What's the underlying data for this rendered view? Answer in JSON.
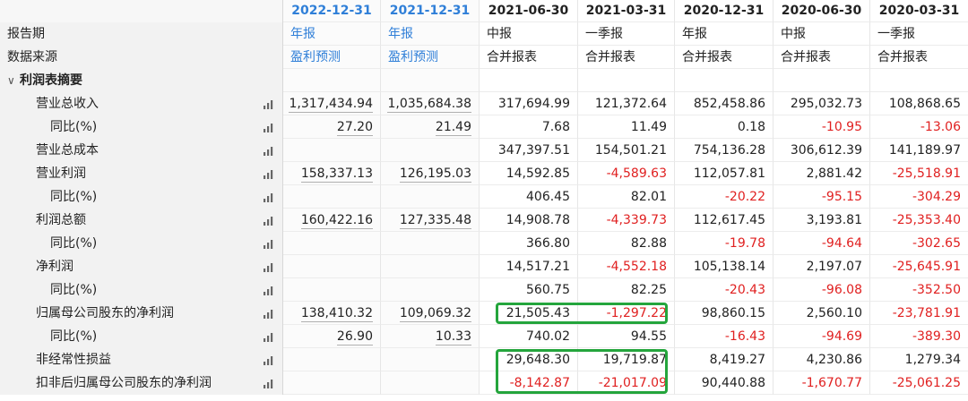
{
  "columns": [
    {
      "date": "2022-12-31",
      "report": "年报",
      "source": "盈利预测",
      "projected": true
    },
    {
      "date": "2021-12-31",
      "report": "年报",
      "source": "盈利预测",
      "projected": true
    },
    {
      "date": "2021-06-30",
      "report": "中报",
      "source": "合并报表",
      "projected": false
    },
    {
      "date": "2021-03-31",
      "report": "一季报",
      "source": "合并报表",
      "projected": false
    },
    {
      "date": "2020-12-31",
      "report": "年报",
      "source": "合并报表",
      "projected": false
    },
    {
      "date": "2020-06-30",
      "report": "中报",
      "source": "合并报表",
      "projected": false
    },
    {
      "date": "2020-03-31",
      "report": "一季报",
      "source": "合并报表",
      "projected": false
    }
  ],
  "header_rows": {
    "report_period_label": "报告期",
    "data_source_label": "数据来源"
  },
  "section": {
    "title": "利润表摘要",
    "caret": "∨"
  },
  "rows": [
    {
      "label": "营业总收入",
      "indent": 1,
      "values": [
        "1,317,434.94",
        "1,035,684.38",
        "317,694.99",
        "121,372.64",
        "852,458.86",
        "295,032.73",
        "108,868.65"
      ]
    },
    {
      "label": "同比(%)",
      "indent": 2,
      "values": [
        "27.20",
        "21.49",
        "7.68",
        "11.49",
        "0.18",
        "-10.95",
        "-13.06"
      ]
    },
    {
      "label": "营业总成本",
      "indent": 1,
      "values": [
        "",
        "",
        "347,397.51",
        "154,501.21",
        "754,136.28",
        "306,612.39",
        "141,189.97"
      ]
    },
    {
      "label": "营业利润",
      "indent": 1,
      "values": [
        "158,337.13",
        "126,195.03",
        "14,592.85",
        "-4,589.63",
        "112,057.81",
        "2,881.42",
        "-25,518.91"
      ]
    },
    {
      "label": "同比(%)",
      "indent": 2,
      "values": [
        "",
        "",
        "406.45",
        "82.01",
        "-20.22",
        "-95.15",
        "-304.29"
      ]
    },
    {
      "label": "利润总额",
      "indent": 1,
      "values": [
        "160,422.16",
        "127,335.48",
        "14,908.78",
        "-4,339.73",
        "112,617.45",
        "3,193.81",
        "-25,353.40"
      ]
    },
    {
      "label": "同比(%)",
      "indent": 2,
      "values": [
        "",
        "",
        "366.80",
        "82.88",
        "-19.78",
        "-94.64",
        "-302.65"
      ]
    },
    {
      "label": "净利润",
      "indent": 1,
      "values": [
        "",
        "",
        "14,517.21",
        "-4,552.18",
        "105,138.14",
        "2,197.07",
        "-25,645.91"
      ]
    },
    {
      "label": "同比(%)",
      "indent": 2,
      "values": [
        "",
        "",
        "560.75",
        "82.25",
        "-20.43",
        "-96.08",
        "-352.50"
      ]
    },
    {
      "label": "归属母公司股东的净利润",
      "indent": 1,
      "values": [
        "138,410.32",
        "109,069.32",
        "21,505.43",
        "-1,297.22",
        "98,860.15",
        "2,560.10",
        "-23,781.91"
      ]
    },
    {
      "label": "同比(%)",
      "indent": 2,
      "values": [
        "26.90",
        "10.33",
        "740.02",
        "94.55",
        "-16.43",
        "-94.69",
        "-389.30"
      ]
    },
    {
      "label": "非经常性损益",
      "indent": 1,
      "values": [
        "",
        "",
        "29,648.30",
        "19,719.87",
        "8,419.27",
        "4,230.86",
        "1,279.34"
      ]
    },
    {
      "label": "扣非后归属母公司股东的净利润",
      "indent": 1,
      "values": [
        "",
        "",
        "-8,142.87",
        "-21,017.09",
        "90,440.88",
        "-1,670.77",
        "-25,061.25"
      ]
    }
  ],
  "colors": {
    "accent_blue": "#2f7fd8",
    "negative_red": "#e02020",
    "highlight_green": "#24a53c"
  },
  "icons": {
    "row_chart": "bar-chart-icon"
  }
}
